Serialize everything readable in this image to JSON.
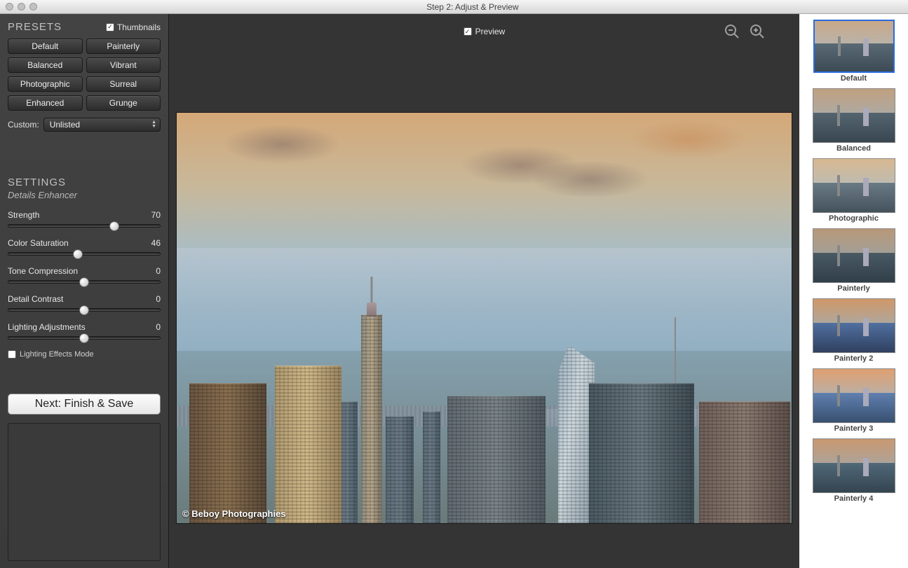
{
  "window": {
    "title": "Step 2: Adjust & Preview"
  },
  "sidebar": {
    "presets_title": "PRESETS",
    "thumbnails_label": "Thumbnails",
    "thumbnails_checked": true,
    "preset_buttons": [
      "Default",
      "Painterly",
      "Balanced",
      "Vibrant",
      "Photographic",
      "Surreal",
      "Enhanced",
      "Grunge"
    ],
    "custom_label": "Custom:",
    "custom_selected": "Unlisted",
    "settings_title": "SETTINGS",
    "settings_subtitle": "Details Enhancer",
    "sliders": [
      {
        "label": "Strength",
        "value": 70,
        "pos": 70
      },
      {
        "label": "Color Saturation",
        "value": 46,
        "pos": 46
      },
      {
        "label": "Tone Compression",
        "value": 0,
        "pos": 50
      },
      {
        "label": "Detail Contrast",
        "value": 0,
        "pos": 50
      },
      {
        "label": "Lighting Adjustments",
        "value": 0,
        "pos": 50
      }
    ],
    "lighting_effects_label": "Lighting Effects Mode",
    "lighting_effects_checked": false,
    "next_button": "Next: Finish & Save"
  },
  "center": {
    "preview_label": "Preview",
    "preview_checked": true,
    "watermark": "© Beboy Photographies"
  },
  "thumbnails": [
    {
      "label": "Default",
      "selected": true,
      "sky": "linear-gradient(#c9a888,#a8c0d0)",
      "city": "linear-gradient(#5a6a74,#3c4a54)"
    },
    {
      "label": "Balanced",
      "selected": false,
      "sky": "linear-gradient(#c0a080,#9ab4c8)",
      "city": "linear-gradient(#556570,#384650)"
    },
    {
      "label": "Photographic",
      "selected": false,
      "sky": "linear-gradient(#d8b890,#a0c0d8)",
      "city": "linear-gradient(#6a7a84,#44525c)"
    },
    {
      "label": "Painterly",
      "selected": false,
      "sky": "linear-gradient(#b89878,#8aa8ba)",
      "city": "linear-gradient(#4a5a64,#303e48)"
    },
    {
      "label": "Painterly 2",
      "selected": false,
      "sky": "linear-gradient(#d09868,#88b8d8)",
      "city": "linear-gradient(#5070a0,#304060)"
    },
    {
      "label": "Painterly 3",
      "selected": false,
      "sky": "linear-gradient(#e0a070,#90c0e0)",
      "city": "linear-gradient(#6080b0,#385070)"
    },
    {
      "label": "Painterly 4",
      "selected": false,
      "sky": "linear-gradient(#c89870,#90b0c8)",
      "city": "linear-gradient(#506878,#344450)"
    }
  ]
}
